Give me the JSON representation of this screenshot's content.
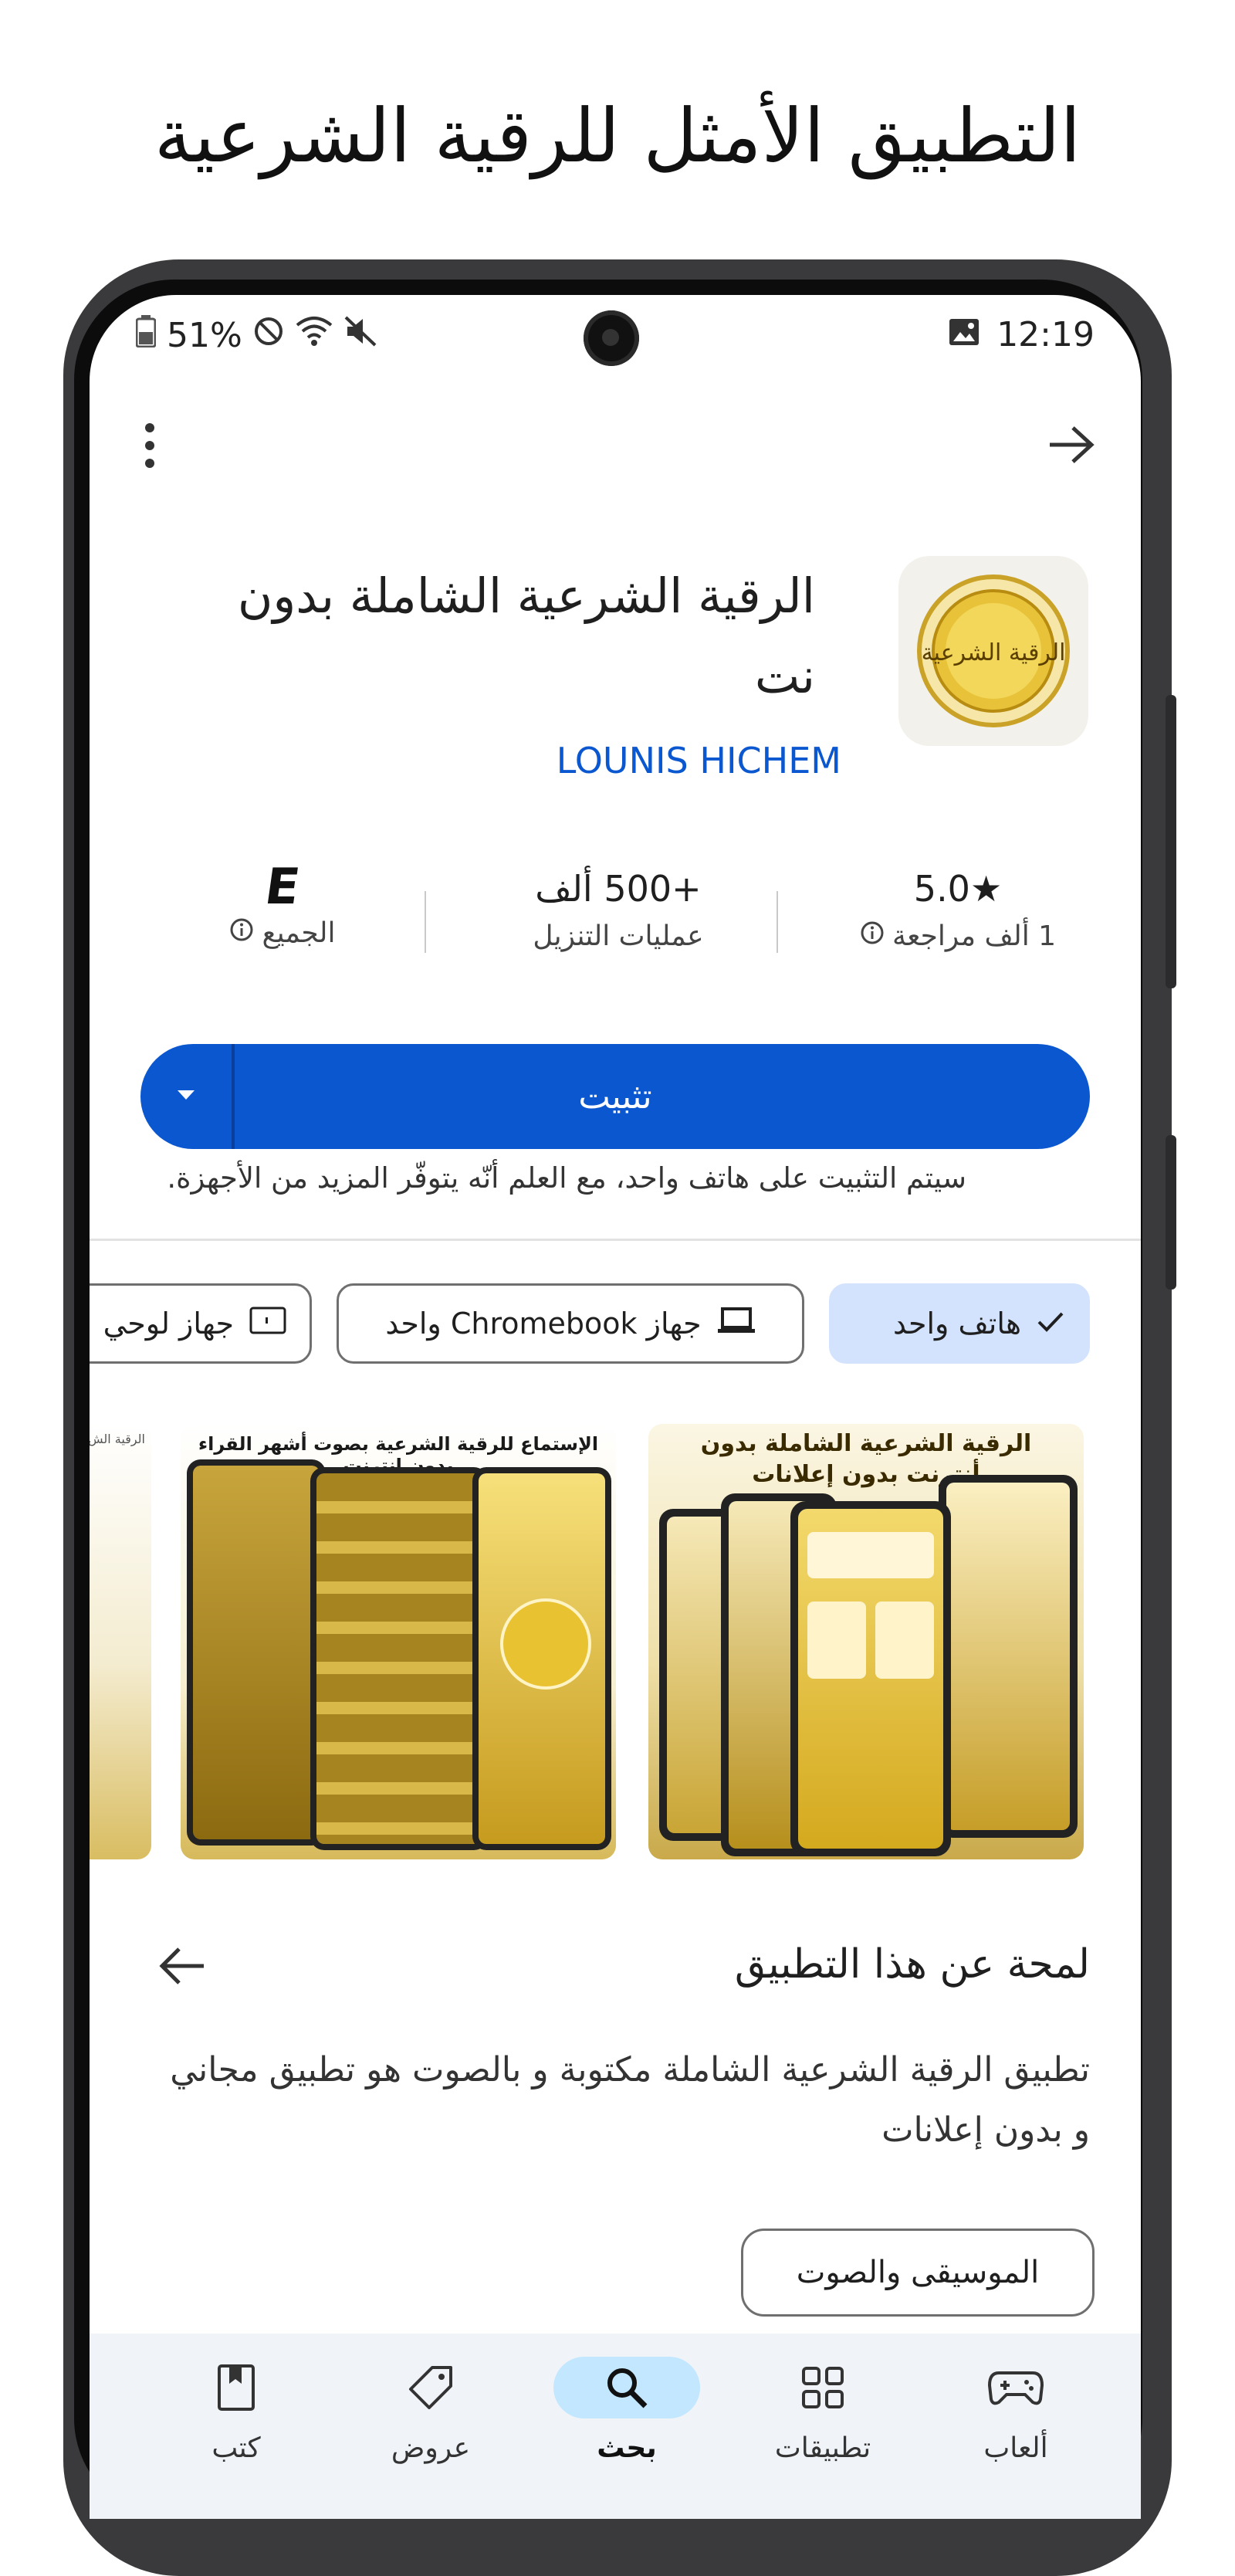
{
  "promo_title": "التطبيق الأمثل للرقية الشرعية",
  "status_bar": {
    "time": "12:19",
    "battery": "51%",
    "icons": [
      "gallery-icon",
      "battery-icon",
      "dnd-icon",
      "wifi-icon",
      "mute-icon"
    ]
  },
  "app": {
    "name": "الرقية الشرعية الشاملة بدون نت",
    "developer": "LOUNIS HICHEM",
    "icon_text": "الرقية الشرعية",
    "colors": {
      "accent": "#0b57d0",
      "selected_chip": "#d3e3fd",
      "gold": "#d4af37"
    }
  },
  "stats": {
    "rating_value": "5.0★",
    "rating_label": "1 ألف مراجعة",
    "downloads_value": "+500 ألف",
    "downloads_label": "عمليات التنزيل",
    "content_rating_badge": "E",
    "content_rating_label": "الجميع"
  },
  "install": {
    "label": "تثبيت",
    "note": "سيتم التثبيت على هاتف واحد، مع العلم أنّه يتوفّر المزيد من الأجهزة."
  },
  "device_chips": [
    {
      "label": "هاتف واحد",
      "icon": "check-icon",
      "selected": true
    },
    {
      "label": "جهاز Chromebook واحد",
      "icon": "laptop-icon",
      "selected": false
    },
    {
      "label": "جهاز لوحي",
      "icon": "tablet-icon",
      "selected": false
    }
  ],
  "screenshots": [
    {
      "caption": "الرقية الشرعية الشاملة بدون أنترنت بدون إعلانات"
    },
    {
      "caption": "الإستماع للرقية الشرعية بصوت أشهر القراء بدون انترنت"
    },
    {
      "caption": "الرقية الش"
    }
  ],
  "about": {
    "title": "لمحة عن هذا التطبيق",
    "description": "تطبيق الرقية الشرعية الشاملة مكتوبة و بالصوت هو تطبيق مجاني و بدون إعلانات",
    "category": "الموسيقى والصوت"
  },
  "nav": {
    "items": [
      {
        "label": "ألعاب",
        "icon": "gamepad-icon"
      },
      {
        "label": "تطبيقات",
        "icon": "apps-grid-icon"
      },
      {
        "label": "بحث",
        "icon": "search-icon",
        "active": true
      },
      {
        "label": "عروض",
        "icon": "tag-icon"
      },
      {
        "label": "كتب",
        "icon": "bookmark-book-icon"
      }
    ]
  }
}
